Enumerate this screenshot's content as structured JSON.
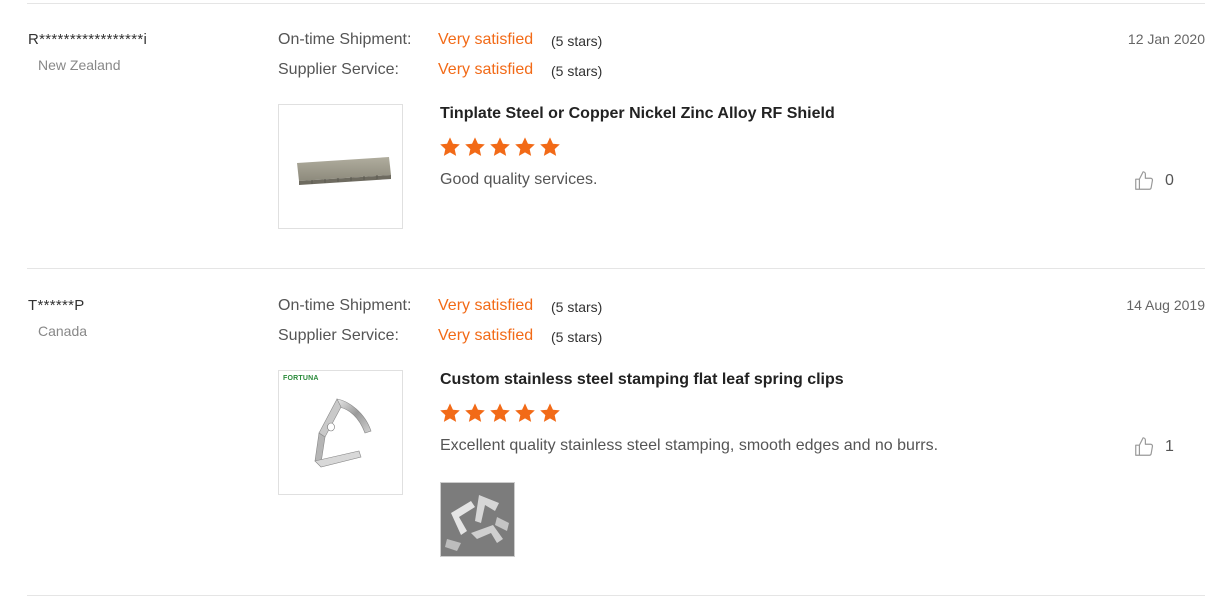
{
  "colors": {
    "accent": "#f26a17",
    "star": "#f26a17"
  },
  "reviews": [
    {
      "buyer": "R*****************i",
      "country": "New Zealand",
      "shipment_label": "On-time Shipment:",
      "shipment_value": "Very satisfied",
      "shipment_stars": "(5 stars)",
      "service_label": "Supplier Service:",
      "service_value": "Very satisfied",
      "service_stars": "(5 stars)",
      "date": "12 Jan 2020",
      "product_title": "Tinplate Steel or Copper Nickel Zinc Alloy RF Shield",
      "rating": 5,
      "comment": "Good quality services.",
      "like_icon": "thumbs-up-icon",
      "likes": "0"
    },
    {
      "buyer": "T******P",
      "country": "Canada",
      "shipment_label": "On-time Shipment:",
      "shipment_value": "Very satisfied",
      "shipment_stars": "(5 stars)",
      "service_label": "Supplier Service:",
      "service_value": "Very satisfied",
      "service_stars": "(5 stars)",
      "date": "14 Aug 2019",
      "product_title": "Custom stainless steel stamping flat leaf spring clips",
      "brand": "FORTUNA",
      "rating": 5,
      "comment": "Excellent quality stainless steel stamping, smooth edges and no burrs.",
      "like_icon": "thumbs-up-icon",
      "likes": "1"
    }
  ]
}
